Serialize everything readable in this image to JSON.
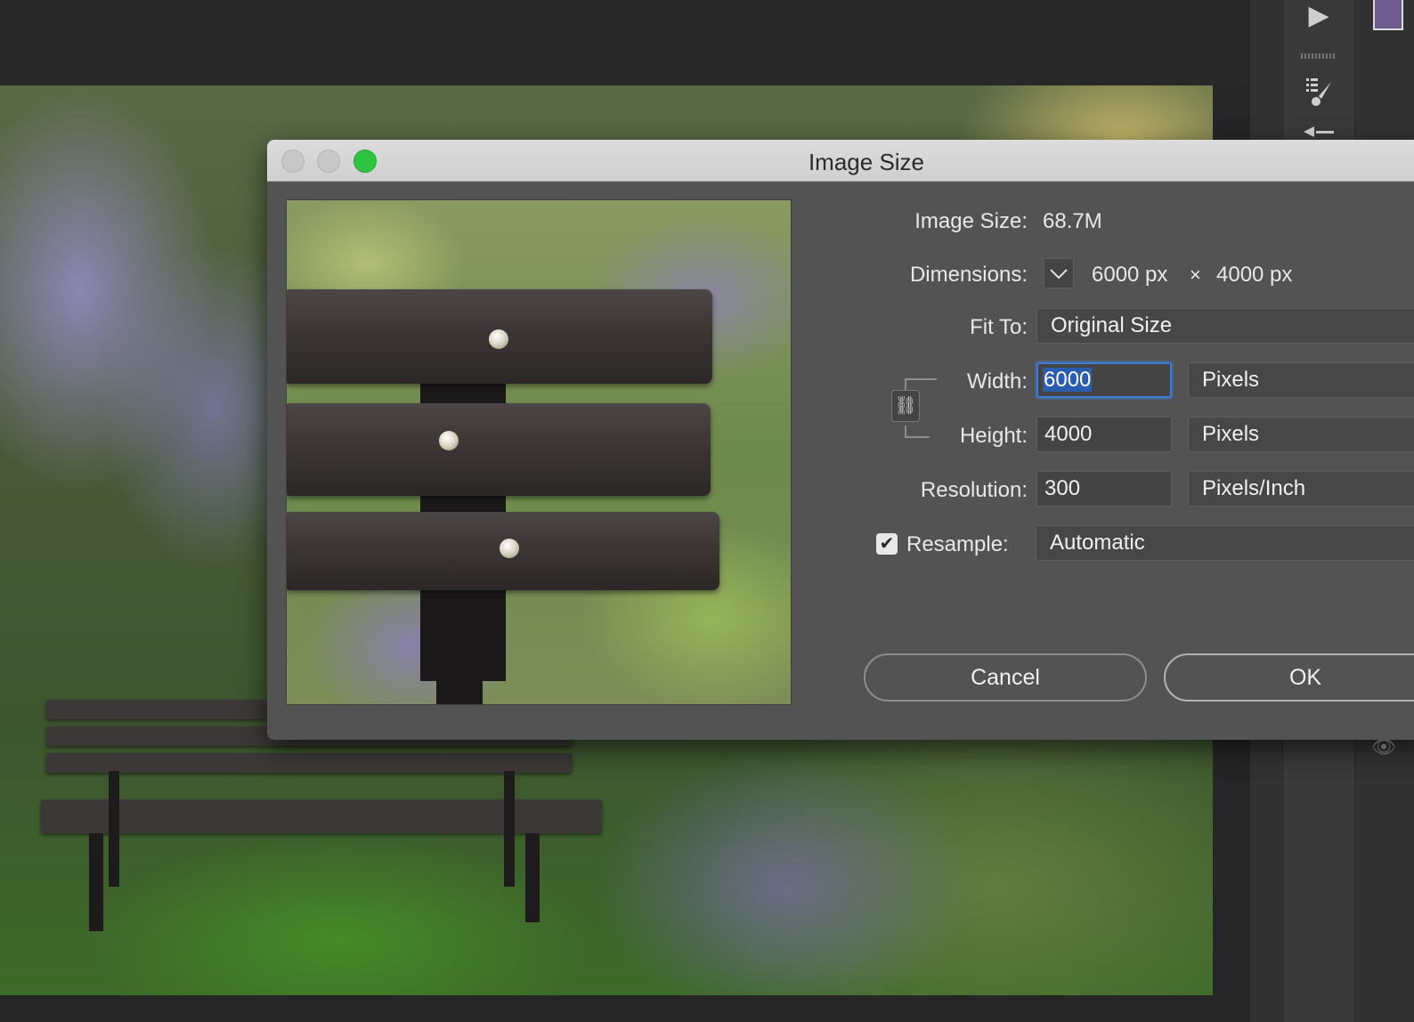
{
  "dialog": {
    "title": "Image Size",
    "image_size_label": "Image Size:",
    "image_size_value": "68.7M",
    "dimensions_label": "Dimensions:",
    "dim_width": "6000 px",
    "dim_times": "×",
    "dim_height": "4000 px",
    "fit_to_label": "Fit To:",
    "fit_to_value": "Original Size",
    "width_label": "Width:",
    "width_value": "6000",
    "width_unit": "Pixels",
    "height_label": "Height:",
    "height_value": "4000",
    "height_unit": "Pixels",
    "resolution_label": "Resolution:",
    "resolution_value": "300",
    "resolution_unit": "Pixels/Inch",
    "resample_label": "Resample:",
    "resample_checked": true,
    "resample_value": "Automatic",
    "cancel_label": "Cancel",
    "ok_label": "OK"
  },
  "icons": {
    "play": "▶",
    "checkmark": "✔",
    "chevron": "﹀",
    "eye": "👁",
    "link": "⛓"
  },
  "colors": {
    "zoom_button": "#2fc440",
    "focus_ring": "#3b7ddd",
    "selection": "#2a5db0",
    "foreground_swatch": "#6d5c8c"
  }
}
